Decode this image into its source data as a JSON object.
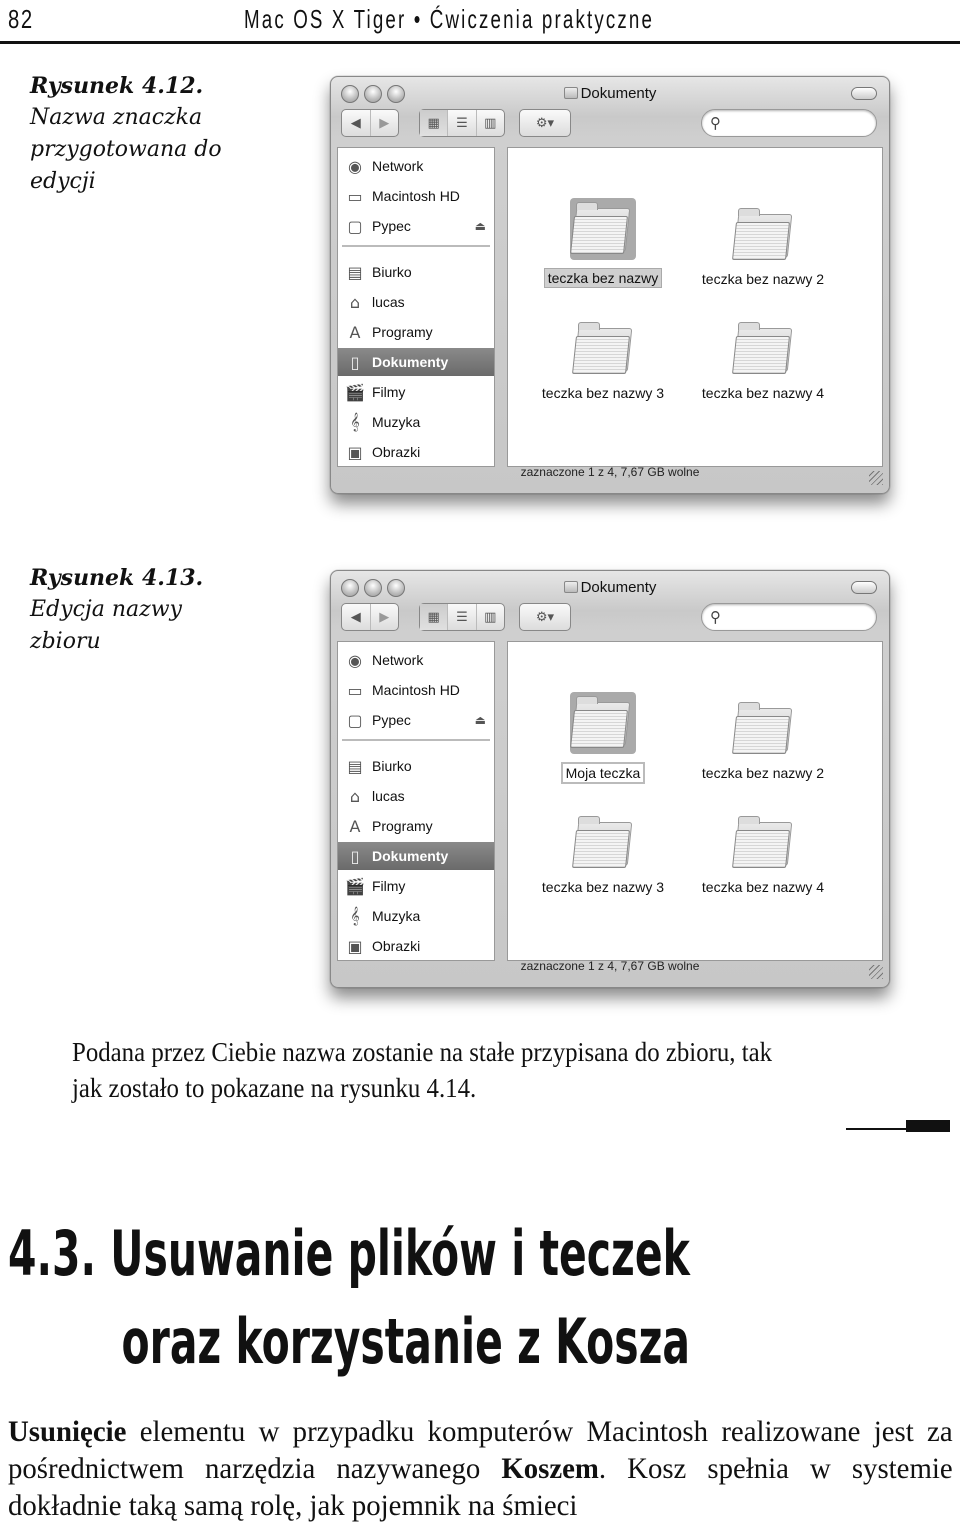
{
  "running_head": {
    "page_number": "82",
    "book_title": "Mac OS X Tiger • Ćwiczenia praktyczne"
  },
  "figures": [
    {
      "caption_number": "Rysunek 4.12.",
      "caption_text": "Nazwa znaczka przygotowana do edycji",
      "window": {
        "title": "Dokumenty",
        "toolbar": {
          "back_icon": "◀",
          "forward_icon": "▶",
          "view_icons": "▦",
          "view_list": "☰",
          "view_columns": "▥",
          "action_icon": "⚙▾",
          "search_icon": "🔍",
          "search_placeholder": ""
        },
        "sidebar": {
          "devices": [
            {
              "label": "Network",
              "icon": "◉"
            },
            {
              "label": "Macintosh HD",
              "icon": "▭"
            },
            {
              "label": "Pypec",
              "icon": "▢",
              "eject": "⏏"
            }
          ],
          "places": [
            {
              "label": "Biurko",
              "icon": "▤"
            },
            {
              "label": "lucas",
              "icon": "⌂"
            },
            {
              "label": "Programy",
              "icon": "A"
            },
            {
              "label": "Dokumenty",
              "icon": "▯",
              "selected": true
            },
            {
              "label": "Filmy",
              "icon": "🎬"
            },
            {
              "label": "Muzyka",
              "icon": "𝄞"
            },
            {
              "label": "Obrazki",
              "icon": "▣"
            }
          ]
        },
        "folders": [
          {
            "name": "teczka bez nazwy",
            "state": "selected"
          },
          {
            "name": "teczka bez nazwy 2"
          },
          {
            "name": "teczka bez nazwy 3"
          },
          {
            "name": "teczka bez nazwy 4"
          }
        ],
        "status": "zaznaczone 1 z 4, 7,67 GB wolne"
      }
    },
    {
      "caption_number": "Rysunek 4.13.",
      "caption_text": "Edycja nazwy zbioru",
      "window": {
        "title": "Dokumenty",
        "toolbar": {
          "back_icon": "◀",
          "forward_icon": "▶",
          "view_icons": "▦",
          "view_list": "☰",
          "view_columns": "▥",
          "action_icon": "⚙▾",
          "search_icon": "🔍",
          "search_placeholder": ""
        },
        "sidebar": {
          "devices": [
            {
              "label": "Network",
              "icon": "◉"
            },
            {
              "label": "Macintosh HD",
              "icon": "▭"
            },
            {
              "label": "Pypec",
              "icon": "▢",
              "eject": "⏏"
            }
          ],
          "places": [
            {
              "label": "Biurko",
              "icon": "▤"
            },
            {
              "label": "lucas",
              "icon": "⌂"
            },
            {
              "label": "Programy",
              "icon": "A"
            },
            {
              "label": "Dokumenty",
              "icon": "▯",
              "selected": true
            },
            {
              "label": "Filmy",
              "icon": "🎬"
            },
            {
              "label": "Muzyka",
              "icon": "𝄞"
            },
            {
              "label": "Obrazki",
              "icon": "▣"
            }
          ]
        },
        "folders": [
          {
            "name": "Moja teczka",
            "state": "editing"
          },
          {
            "name": "teczka bez nazwy 2"
          },
          {
            "name": "teczka bez nazwy 3"
          },
          {
            "name": "teczka bez nazwy 4"
          }
        ],
        "status": "zaznaczone 1 z 4, 7,67 GB wolne"
      }
    }
  ],
  "paragraph": "Podana przez Ciebie nazwa zostanie na stałe przypisana do zbioru, tak jak zostało to pokazane na rysunku 4.14.",
  "section": {
    "heading_line1": "4.3. Usuwanie plików i teczek",
    "heading_line2": "oraz korzystanie z Kosza"
  },
  "body": {
    "term1": "Usunięcie",
    "text1": " elementu w przypadku komputerów Macintosh realizowane jest za pośrednictwem narzędzia nazywanego ",
    "term2": "Koszem",
    "text2": ". Kosz spełnia w systemie dokładnie taką samą rolę, jak pojemnik na śmieci"
  }
}
